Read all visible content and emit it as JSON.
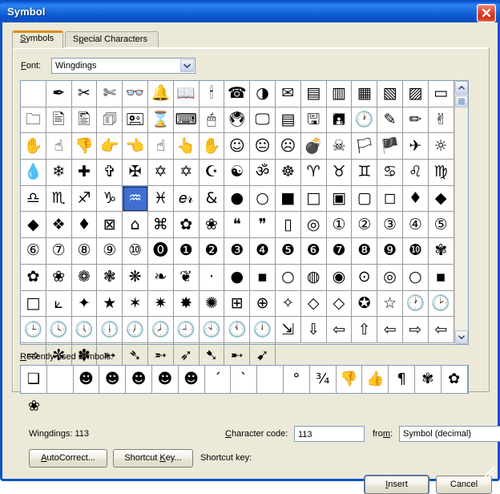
{
  "window": {
    "title": "Symbol",
    "close_icon": "close-x-icon"
  },
  "tabs": [
    {
      "label": "Symbols",
      "mnemonic": "S",
      "active": true
    },
    {
      "label": "Special Characters",
      "mnemonic": "p",
      "active": false
    }
  ],
  "font": {
    "label": "Font:",
    "value": "Wingdings",
    "arrow_icon": "chevron-down-icon"
  },
  "symbol_grid": {
    "columns": 17,
    "rows": 10,
    "selected_index": 72,
    "cells": [
      "",
      "✒",
      "✂",
      "✄",
      "👓",
      "🔔",
      "📖",
      "🕯",
      "☎",
      "◑",
      "✉",
      "▤",
      "▥",
      "▦",
      "▧",
      "▨",
      "▭",
      "🗀",
      "🖹",
      "🖺",
      "🗊",
      "🖭",
      "⌛",
      "⌨",
      "🖱",
      "🖲",
      "🖵",
      "▤",
      "🖫",
      "🖪",
      "🕐",
      "✎",
      "✏",
      "✌",
      "✋",
      "☝",
      "👎",
      "👉",
      "👈",
      "☝",
      "👆",
      "✋",
      "☺",
      "😐",
      "☹",
      "💣",
      "☠",
      "🏳",
      "🏴",
      "✈",
      "☼",
      "💧",
      "❄",
      "✚",
      "✞",
      "✠",
      "✡",
      "✡",
      "☪",
      "☯",
      "ॐ",
      "☸",
      "♈",
      "♉",
      "♊",
      "♋",
      "♌",
      "♍",
      "♎",
      "♏",
      "♐",
      "♑",
      "♒",
      "♓",
      "𝑒𝓇",
      "&",
      "●",
      "○",
      "■",
      "□",
      "▣",
      "▢",
      "◻",
      "♦",
      "◆",
      "◆",
      "❖",
      "♦",
      "⊠",
      "⌂",
      "⌘",
      "✿",
      "❀",
      "❝",
      "❞",
      "▯",
      "◎",
      "①",
      "②",
      "③",
      "④",
      "⑤",
      "⑥",
      "⑦",
      "⑧",
      "⑨",
      "⑩",
      "⓿",
      "❶",
      "❷",
      "❸",
      "❹",
      "❺",
      "❻",
      "❼",
      "❽",
      "❾",
      "❿",
      "✾",
      "✿",
      "❀",
      "❁",
      "❃",
      "❋",
      "❧",
      "❦",
      "·",
      "●",
      "▪",
      "○",
      "◍",
      "◉",
      "⊙",
      "◎",
      "○",
      "▪",
      "□",
      "⟀",
      "✦",
      "★",
      "✶",
      "✷",
      "✸",
      "✺",
      "⊞",
      "⊕",
      "✧",
      "◇",
      "◇",
      "✪",
      "☆",
      "🕐",
      "🕑",
      "🕒",
      "🕓",
      "🕔",
      "🕕",
      "🕖",
      "🕗",
      "🕘",
      "🕙",
      "🕚",
      "🕛",
      "⇲",
      "⇩",
      "⇦",
      "⇧",
      "⇦",
      "⇨",
      "⇦",
      "⇨",
      "✼",
      "✽",
      "➳",
      "➴",
      "➵",
      "➶",
      "➷",
      "➸",
      "➹"
    ]
  },
  "recent": {
    "label": "Recently used symbols:",
    "cells": [
      "❑",
      "",
      "☻",
      "☻",
      "☻",
      "☻",
      "☻",
      "ˊ",
      "ˋ",
      "",
      "°",
      "¾",
      "👎",
      "👍",
      "¶",
      "✾",
      "✿",
      "❀"
    ]
  },
  "info": {
    "font_code_text": "Wingdings: 113",
    "charcode_label": "Character code:",
    "charcode_mnemonic": "C",
    "charcode_value": "113",
    "from_label": "from:",
    "from_mnemonic": "m",
    "from_value": "Symbol (decimal)",
    "from_arrow_icon": "chevron-down-icon"
  },
  "actions": {
    "autocorrect_label": "AutoCorrect...",
    "autocorrect_mnemonic": "A",
    "shortcutkey_label": "Shortcut Key...",
    "shortcutkey_mnemonic": "K",
    "shortcut_key_text": "Shortcut key:"
  },
  "footer": {
    "insert_label": "Insert",
    "insert_mnemonic": "I",
    "cancel_label": "Cancel"
  },
  "colors": {
    "titlebar_blue": "#0c5ad8",
    "dialog_face": "#ece9d8",
    "selection_blue": "#3f6fd1",
    "active_tab_accent": "#e08a1e",
    "field_border": "#7f9db9",
    "close_red": "#d02d14"
  }
}
